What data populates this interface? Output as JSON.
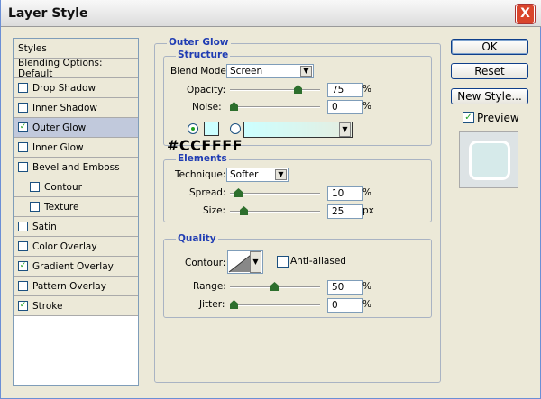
{
  "window": {
    "title": "Layer Style",
    "close_glyph": "X"
  },
  "panel": {
    "items": [
      {
        "label": "Styles",
        "checked": null
      },
      {
        "label": "Blending Options: Default",
        "checked": null
      },
      {
        "label": "Drop Shadow",
        "checked": false
      },
      {
        "label": "Inner Shadow",
        "checked": false
      },
      {
        "label": "Outer Glow",
        "checked": true
      },
      {
        "label": "Inner Glow",
        "checked": false
      },
      {
        "label": "Bevel and Emboss",
        "checked": false
      },
      {
        "label": "Contour",
        "checked": false
      },
      {
        "label": "Texture",
        "checked": false
      },
      {
        "label": "Satin",
        "checked": false
      },
      {
        "label": "Color Overlay",
        "checked": false
      },
      {
        "label": "Gradient Overlay",
        "checked": true
      },
      {
        "label": "Pattern Overlay",
        "checked": false
      },
      {
        "label": "Stroke",
        "checked": true
      }
    ]
  },
  "outer_glow": {
    "title": "Outer Glow",
    "structure": {
      "title": "Structure",
      "blend_mode_label": "Blend Mode:",
      "blend_mode": "Screen",
      "opacity_label": "Opacity:",
      "opacity": "75",
      "noise_label": "Noise:",
      "noise": "0",
      "unit": "%",
      "color_hex": "#CCFFFF"
    },
    "elements": {
      "title": "Elements",
      "technique_label": "Technique:",
      "technique": "Softer",
      "spread_label": "Spread:",
      "spread": "10",
      "spread_unit": "%",
      "size_label": "Size:",
      "size": "25",
      "size_unit": "px"
    },
    "quality": {
      "title": "Quality",
      "contour_label": "Contour:",
      "antialiased_label": "Anti-aliased",
      "range_label": "Range:",
      "range": "50",
      "jitter_label": "Jitter:",
      "jitter": "0",
      "unit": "%"
    }
  },
  "buttons": {
    "ok": "OK",
    "reset": "Reset",
    "new_style": "New Style...",
    "preview": "Preview"
  },
  "colors": {
    "glow": "#CCFFFF",
    "accent": "#1f3cb3"
  }
}
